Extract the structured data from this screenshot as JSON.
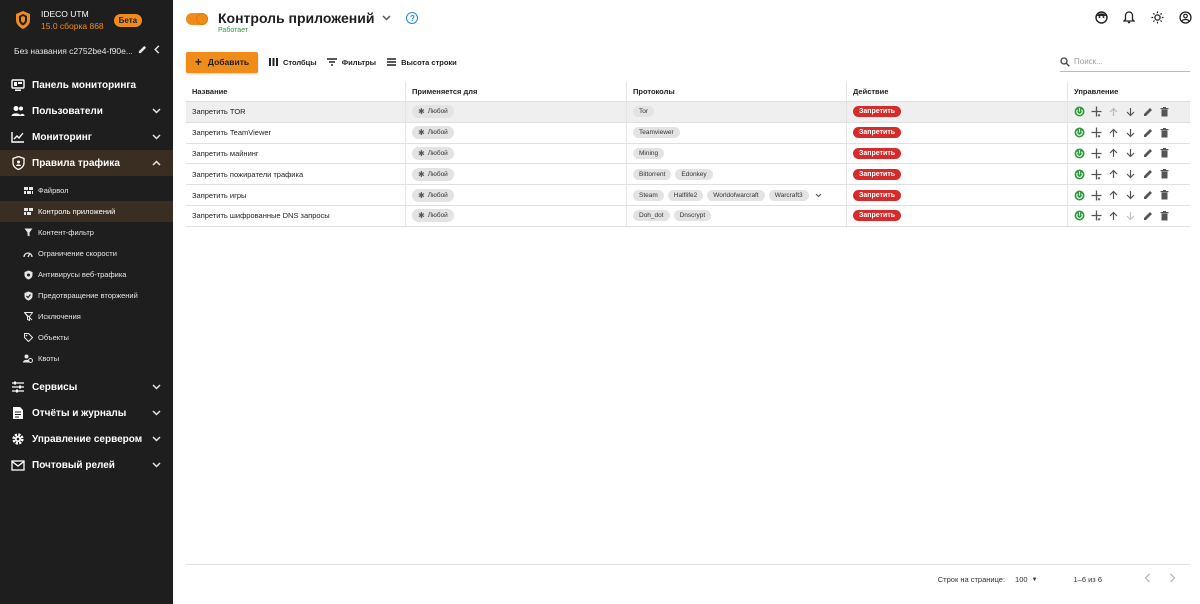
{
  "brand": {
    "name": "IDECO UTM",
    "version": "15.0 сборка 868",
    "badge": "Бета",
    "accent": "#f08c1a"
  },
  "device": {
    "name": "Без названия c2752be4-f90e..."
  },
  "nav": {
    "items": [
      {
        "label": "Панель мониторинга",
        "icon": "monitor-icon"
      },
      {
        "label": "Пользователи",
        "icon": "users-icon"
      },
      {
        "label": "Мониторинг",
        "icon": "chart-icon"
      },
      {
        "label": "Правила трафика",
        "icon": "shield-icon"
      },
      {
        "label": "Сервисы",
        "icon": "sliders-icon"
      },
      {
        "label": "Отчёты и журналы",
        "icon": "file-icon"
      },
      {
        "label": "Управление сервером",
        "icon": "gear-icon"
      },
      {
        "label": "Почтовый релей",
        "icon": "mail-icon"
      }
    ],
    "sub_items": [
      {
        "label": "Файрвол",
        "icon": "firewall-icon"
      },
      {
        "label": "Контроль приложений",
        "icon": "apps-icon"
      },
      {
        "label": "Контент-фильтр",
        "icon": "filter-icon"
      },
      {
        "label": "Ограничение скорости",
        "icon": "speed-icon"
      },
      {
        "label": "Антивирусы веб-трафика",
        "icon": "antivirus-icon"
      },
      {
        "label": "Предотвращение вторжений",
        "icon": "ips-icon"
      },
      {
        "label": "Исключения",
        "icon": "exclusion-icon"
      },
      {
        "label": "Объекты",
        "icon": "tag-icon"
      },
      {
        "label": "Квоты",
        "icon": "quota-icon"
      }
    ]
  },
  "header": {
    "title": "Контроль приложений",
    "status": "Работает",
    "status_color": "#2e9a3c",
    "help": "?"
  },
  "toolbar": {
    "add_label": "Добавить",
    "columns_label": "Столбцы",
    "filters_label": "Фильтры",
    "row_height_label": "Высота строки",
    "search_placeholder": "Поиск..."
  },
  "table": {
    "headers": {
      "name": "Название",
      "applies": "Применяется для",
      "protocols": "Протоколы",
      "action": "Действие",
      "manage": "Управление"
    },
    "rows": [
      {
        "name": "Запретить TOR",
        "applies": "Любой",
        "protocols": [
          "Tor"
        ],
        "action": "Запретить"
      },
      {
        "name": "Запретить TeamViewer",
        "applies": "Любой",
        "protocols": [
          "Teamviewer"
        ],
        "action": "Запретить"
      },
      {
        "name": "Запретить майнинг",
        "applies": "Любой",
        "protocols": [
          "Mining"
        ],
        "action": "Запретить"
      },
      {
        "name": "Запретить пожиратели трафика",
        "applies": "Любой",
        "protocols": [
          "Bittorrent",
          "Edonkey"
        ],
        "action": "Запретить"
      },
      {
        "name": "Запретить игры",
        "applies": "Любой",
        "protocols": [
          "Steam",
          "Halflife2",
          "Worldofwarcraft",
          "Warcraft3"
        ],
        "action": "Запретить"
      },
      {
        "name": "Запретить шифрованные DNS запросы",
        "applies": "Любой",
        "protocols": [
          "Doh_dot",
          "Dnscrypt"
        ],
        "action": "Запретить"
      }
    ]
  },
  "footer": {
    "rows_per_page_label": "Строк на странице:",
    "rows_per_page": "100",
    "range": "1–6 из 6"
  },
  "colors": {
    "deny": "#d52b2b",
    "enabled": "#2e9a3c",
    "sidebar_bg": "#1e1e1e"
  }
}
